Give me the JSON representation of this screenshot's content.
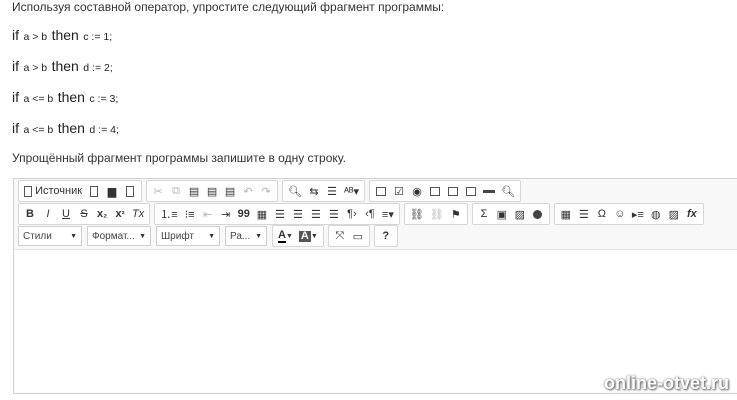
{
  "question": {
    "instruction": "Используя составной оператор, упростите следующий фрагмент программы:",
    "lines": [
      {
        "kw_if": "if",
        "cond": "a > b",
        "kw_then": "then",
        "stmt": "c := 1;"
      },
      {
        "kw_if": "if",
        "cond": "a > b",
        "kw_then": "then",
        "stmt": "d := 2;"
      },
      {
        "kw_if": "if",
        "cond": "a <= b",
        "kw_then": "then",
        "stmt": "c := 3;"
      },
      {
        "kw_if": "if",
        "cond": "a <= b",
        "kw_then": "then",
        "stmt": "d := 4;"
      }
    ],
    "answer_prompt": "Упрощённый фрагмент программы запишите в одну строку."
  },
  "editor": {
    "toolbar": {
      "source_label": "Источник",
      "styles_label": "Стили",
      "format_label": "Формат...",
      "font_label": "Шрифт",
      "size_label": "Ра...",
      "bold": "B",
      "italic": "I",
      "underline": "U",
      "strike": "S",
      "subscript": "x",
      "subscript_mark": "₂",
      "superscript": "x",
      "superscript_mark": "²",
      "remove_format": "Tx",
      "blockquote": "99",
      "text_color": "A",
      "bg_color": "A",
      "help": "?",
      "sigma": "Σ",
      "omega": "Ω",
      "fx": "fx"
    },
    "content": ""
  },
  "watermark": "online-otvet.ru"
}
